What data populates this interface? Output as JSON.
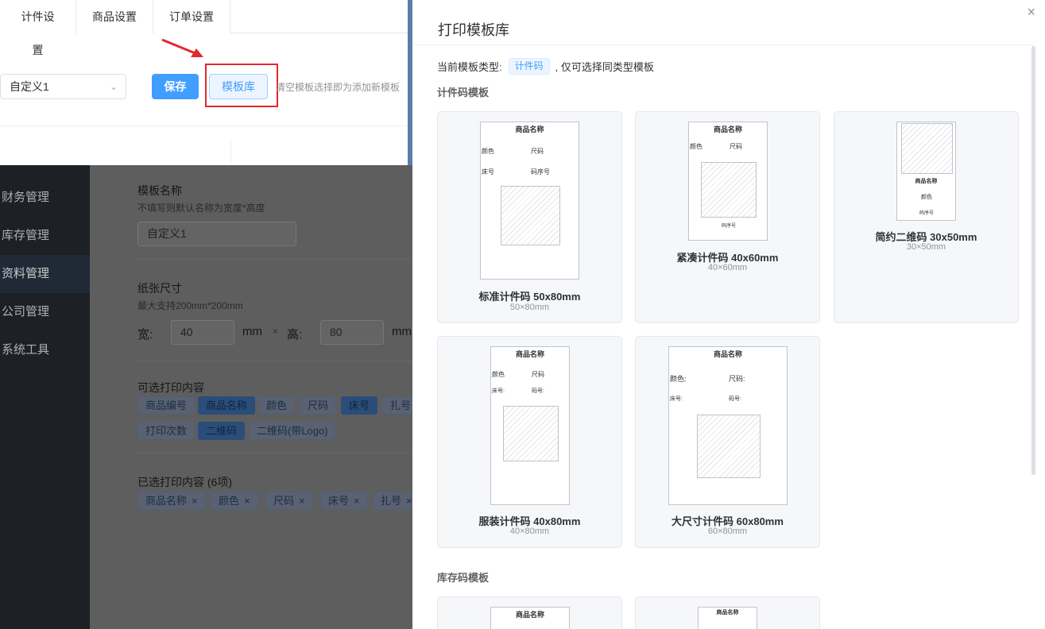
{
  "top_card": {
    "tabs": [
      "计件设置",
      "商品设置",
      "订单设置"
    ],
    "template_select": "自定义1",
    "save_label": "保存",
    "library_label": "模板库",
    "empty_hint": "清空模板选择即为添加新模板"
  },
  "sidebar": {
    "items": [
      "财务管理",
      "库存管理",
      "资料管理",
      "公司管理",
      "系统工具"
    ]
  },
  "bg_form": {
    "name_label": "模板名称",
    "name_hint": "不填写则默认名称为宽度*高度",
    "name_value": "自定义1",
    "paper_label": "纸张尺寸",
    "paper_hint": "最大支持200mm*200mm",
    "width_label": "宽:",
    "width_value": "40",
    "unit": "mm",
    "times": "×",
    "height_label": "高:",
    "height_value": "80",
    "unit2": "mm",
    "optional_label": "可选打印内容",
    "optional_tags": [
      "商品编号",
      "商品名称",
      "颜色",
      "尺码",
      "床号",
      "扎号",
      "打印次数",
      "二维码",
      "二维码(带Logo)"
    ],
    "selected_label": "已选打印内容 (6项)",
    "selected_tags": [
      "商品名称",
      "颜色",
      "尺码",
      "床号",
      "扎号"
    ]
  },
  "drawer": {
    "title": "打印模板库",
    "close": "×",
    "current_type_label": "当前模板类型:",
    "current_type": "计件码",
    "current_type_note": ", 仅可选择同类型模板",
    "group1_title": "计件码模板",
    "group2_title": "库存码模板",
    "templates": [
      {
        "name": "标准计件码 50x80mm",
        "size": "50×80mm",
        "p_title": "商品名称",
        "f1": "颜色",
        "f2": "尺码",
        "f3": "床号",
        "f4": "码序号"
      },
      {
        "name": "紧凑计件码 40x60mm",
        "size": "40×60mm",
        "p_title": "商品名称",
        "f1": "颜色",
        "f2": "尺码",
        "f3": "码序号"
      },
      {
        "name": "简约二维码 30x50mm",
        "size": "30×50mm",
        "p_title": "商品名称",
        "f1": "颜色",
        "f2": "码序号"
      },
      {
        "name": "服装计件码 40x80mm",
        "size": "40×80mm",
        "p_title": "商品名称",
        "f1": "颜色",
        "f2": "尺码",
        "f3": "床号:",
        "f4": "码号:"
      },
      {
        "name": "大尺寸计件码 60x80mm",
        "size": "60×80mm",
        "p_title": "商品名称",
        "f1": "颜色:",
        "f2": "尺码:",
        "f3": "床号:",
        "f4": "码号:"
      }
    ],
    "stock_templates": [
      {
        "p_title": "商品名称"
      },
      {
        "p_title": "商品名称"
      }
    ]
  }
}
